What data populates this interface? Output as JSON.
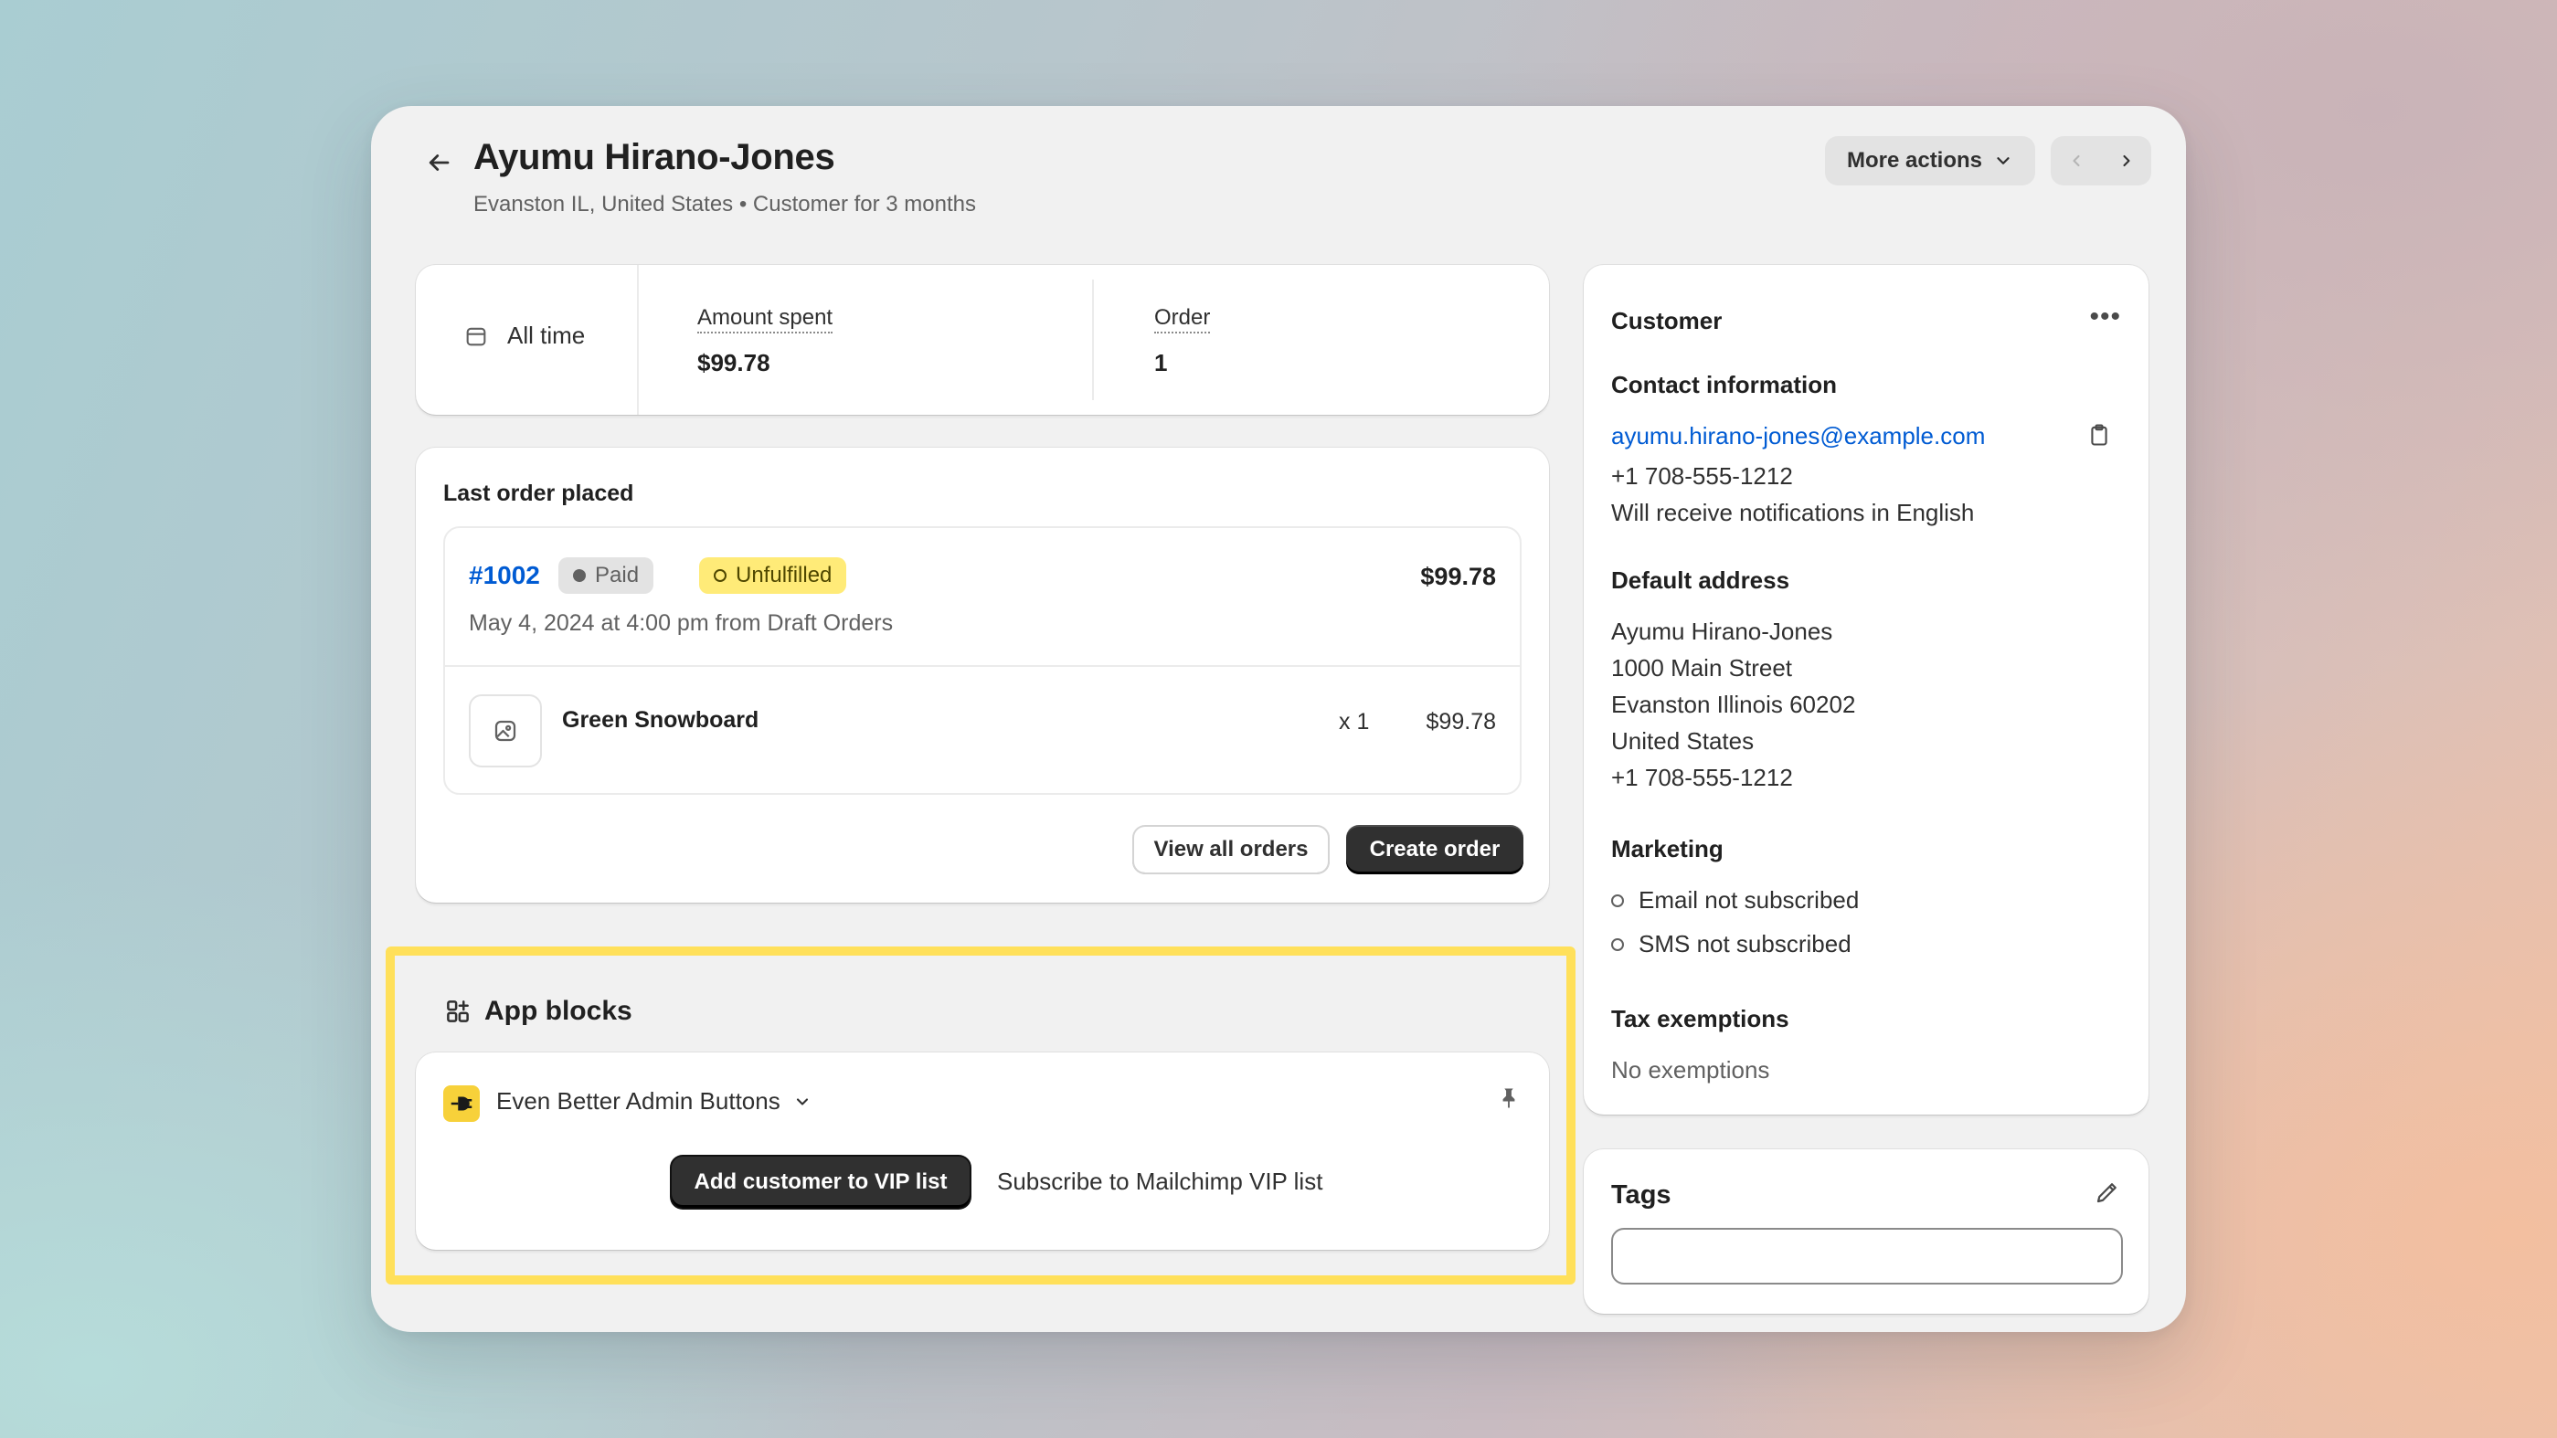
{
  "header": {
    "title": "Ayumu Hirano-Jones",
    "subtitle": "Evanston IL, United States • Customer for 3 months",
    "more_actions_label": "More actions",
    "icons": {
      "back": "arrow-left-icon",
      "more": "chevron-down-icon",
      "prev": "chevron-left-icon",
      "next": "chevron-right-icon"
    }
  },
  "stats": {
    "range_label": "All time",
    "amount_label": "Amount spent",
    "amount_value": "$99.78",
    "order_label": "Order",
    "order_value": "1"
  },
  "last_order": {
    "title": "Last order placed",
    "order_number": "#1002",
    "payment_status": "Paid",
    "fulfillment_status": "Unfulfilled",
    "total": "$99.78",
    "date_line": "May 4, 2024 at 4:00 pm from Draft Orders",
    "item": {
      "name": "Green Snowboard",
      "qty": "x 1",
      "price": "$99.78"
    },
    "view_all_label": "View all orders",
    "create_label": "Create order"
  },
  "app_blocks": {
    "title": "App blocks",
    "app_name": "Even Better Admin Buttons",
    "primary_button": "Add customer to VIP list",
    "secondary_button": "Subscribe to Mailchimp VIP list",
    "highlight_color": "#ffe05a"
  },
  "customer": {
    "title": "Customer",
    "contact_title": "Contact information",
    "email": "ayumu.hirano-jones@example.com",
    "phone": "+1 708-555-1212",
    "notifications": "Will receive notifications in English",
    "address_title": "Default address",
    "address_lines": [
      "Ayumu Hirano-Jones",
      "1000 Main Street",
      "Evanston Illinois 60202",
      "United States",
      "+1 708-555-1212"
    ],
    "marketing_title": "Marketing",
    "email_marketing": "Email not subscribed",
    "sms_marketing": "SMS not subscribed",
    "tax_title": "Tax exemptions",
    "tax_value": "No exemptions"
  },
  "tags": {
    "title": "Tags",
    "value": ""
  },
  "colors": {
    "link": "#005bd3",
    "unfulfilled_badge": "#ffeb78",
    "primary_button": "#303030"
  }
}
